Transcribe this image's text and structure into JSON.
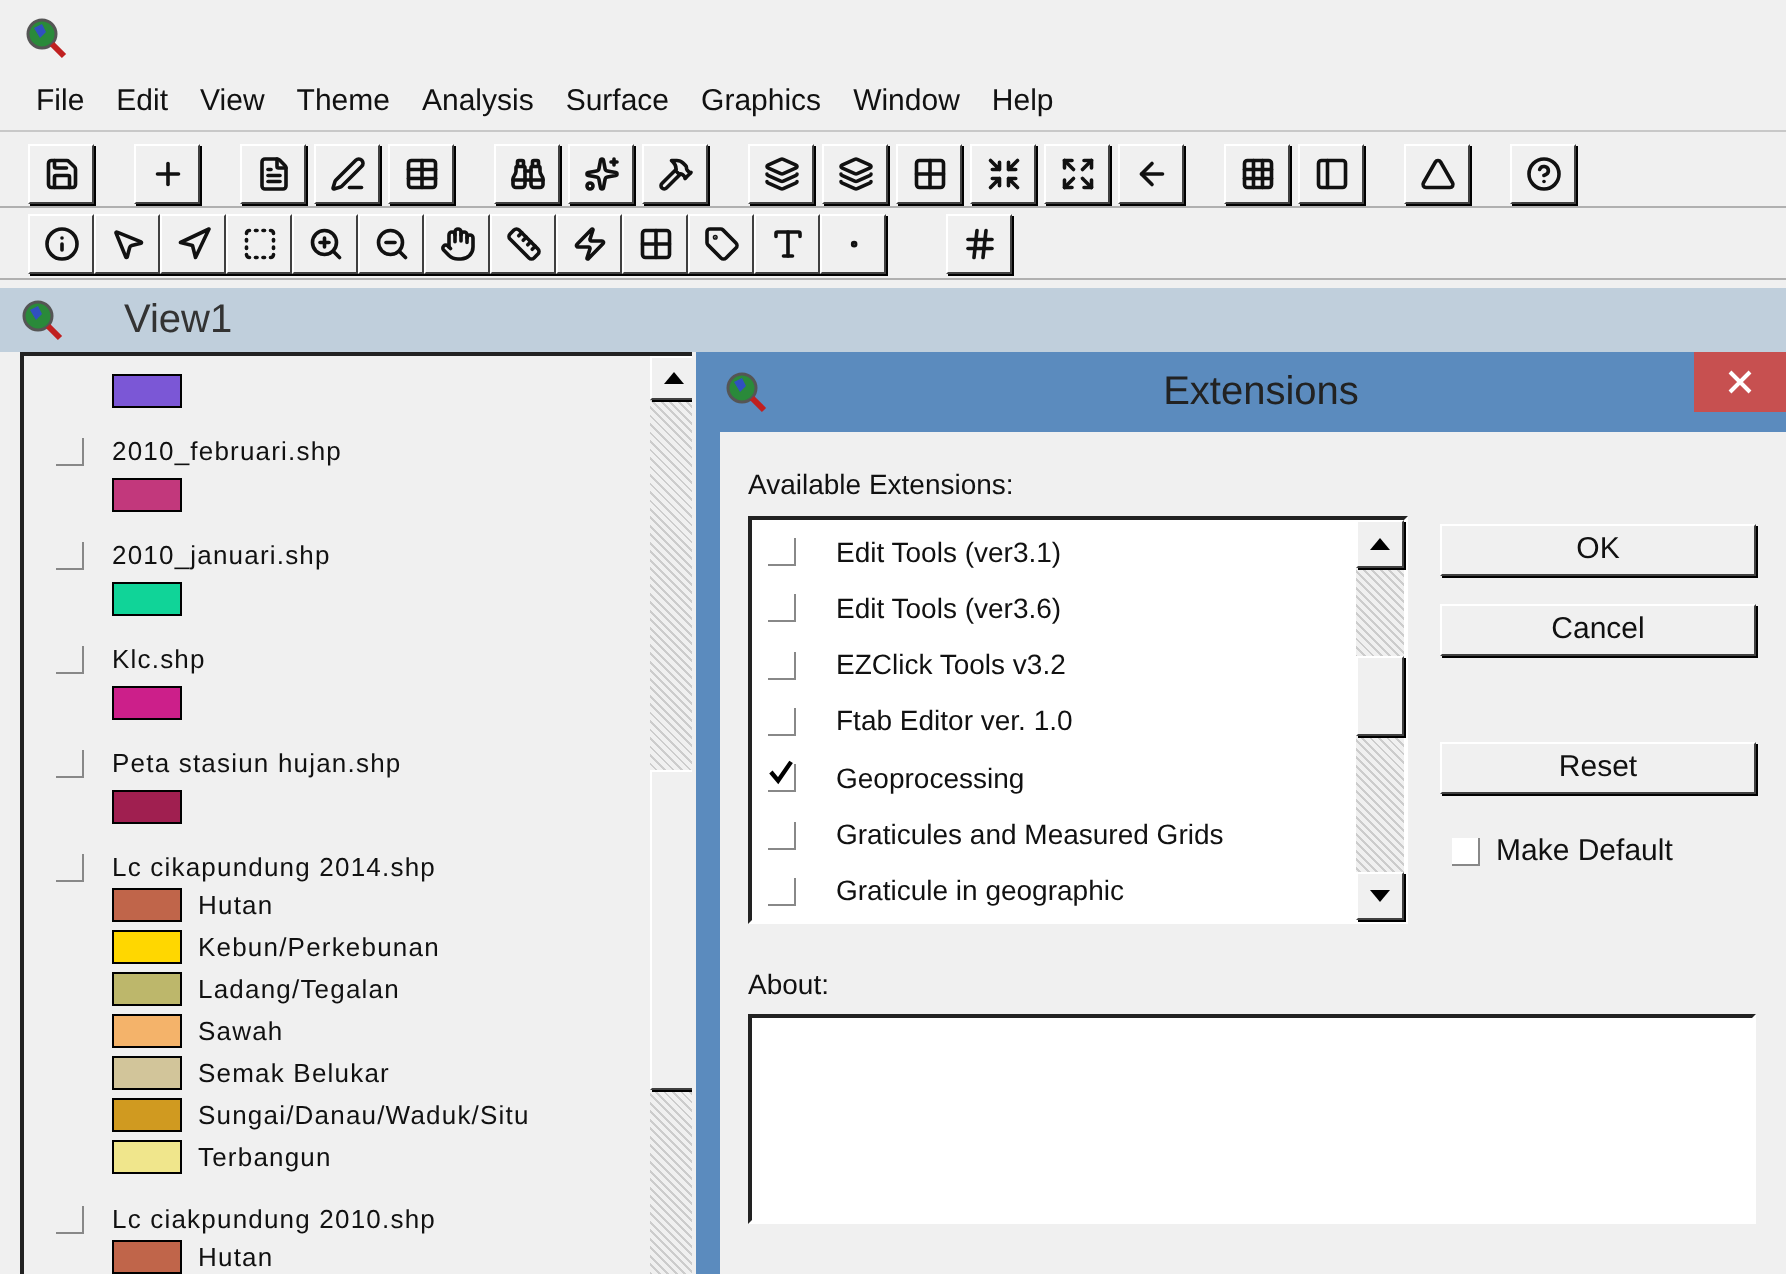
{
  "menu": [
    {
      "label": "File"
    },
    {
      "label": "Edit"
    },
    {
      "label": "View"
    },
    {
      "label": "Theme"
    },
    {
      "label": "Analysis"
    },
    {
      "label": "Surface"
    },
    {
      "label": "Graphics"
    },
    {
      "label": "Window"
    },
    {
      "label": "Help"
    }
  ],
  "view": {
    "title": "View1"
  },
  "legend": [
    {
      "color": "#7b57d6"
    },
    {
      "name": "2010_februari.shp",
      "checked": false,
      "color": "#c2387c"
    },
    {
      "name": "2010_januari.shp",
      "checked": false,
      "color": "#10d498"
    },
    {
      "name": "Klc.shp",
      "checked": false,
      "color": "#cc1f8a"
    },
    {
      "name": "Peta stasiun hujan.shp",
      "checked": false,
      "color": "#a01f50"
    },
    {
      "name": "Lc cikapundung 2014.shp",
      "checked": false,
      "classes": [
        {
          "label": "Hutan",
          "color": "#c0654a"
        },
        {
          "label": "Kebun/Perkebunan",
          "color": "#ffd700"
        },
        {
          "label": "Ladang/Tegalan",
          "color": "#bdb76b"
        },
        {
          "label": "Sawah",
          "color": "#f4b36a"
        },
        {
          "label": "Semak Belukar",
          "color": "#d2c59a"
        },
        {
          "label": "Sungai/Danau/Waduk/Situ",
          "color": "#d09a20"
        },
        {
          "label": "Terbangun",
          "color": "#f0e68c"
        }
      ]
    },
    {
      "name": "Lc ciakpundung 2010.shp",
      "checked": false,
      "classes": [
        {
          "label": "Hutan",
          "color": "#c0654a"
        }
      ]
    }
  ],
  "dialog": {
    "title": "Extensions",
    "list_label": "Available Extensions:",
    "extensions": [
      {
        "name": "Edit Tools (ver3.1)",
        "checked": false
      },
      {
        "name": "Edit Tools (ver3.6)",
        "checked": false
      },
      {
        "name": "EZClick Tools v3.2",
        "checked": false
      },
      {
        "name": "Ftab Editor ver. 1.0",
        "checked": false
      },
      {
        "name": "Geoprocessing",
        "checked": true
      },
      {
        "name": "Graticules and Measured Grids",
        "checked": false
      },
      {
        "name": "Graticule in geographic",
        "checked": false
      }
    ],
    "buttons": [
      {
        "label": "OK"
      },
      {
        "label": "Cancel"
      },
      {
        "label": "Reset"
      }
    ],
    "make_default": {
      "label": "Make Default",
      "checked": false
    },
    "about_label": "About:"
  }
}
